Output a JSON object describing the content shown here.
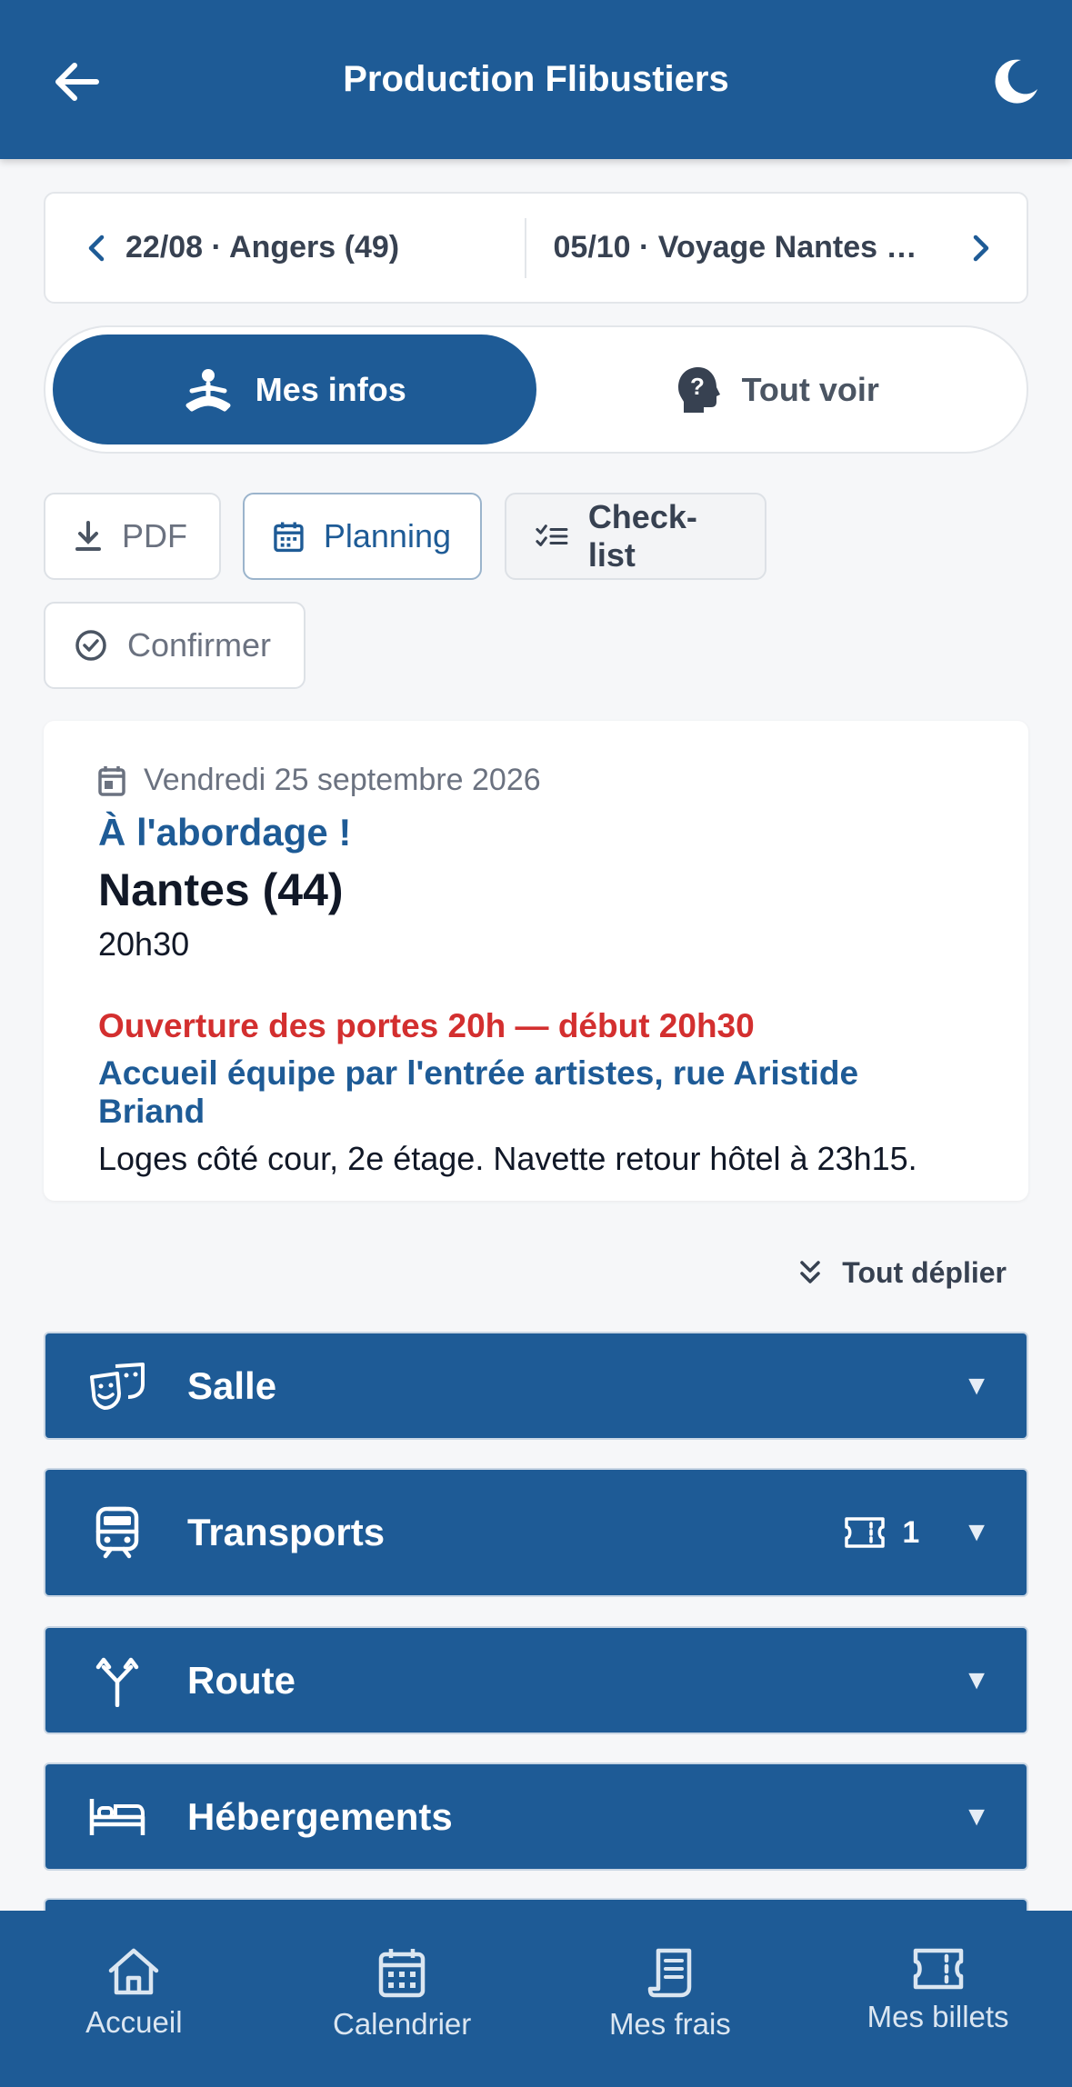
{
  "header": {
    "title": "Production Flibustiers",
    "back_icon": "arrow-left-icon",
    "theme_icon": "moon-icon"
  },
  "date_nav": {
    "prev_label": "22/08 · Angers (49)",
    "next_label": "05/10 · Voyage Nantes …"
  },
  "view_toggle": {
    "mine_label": "Mes infos",
    "all_label": "Tout voir"
  },
  "actions": {
    "pdf": "PDF",
    "planning": "Planning",
    "checklist": "Check-list",
    "confirm": "Confirmer"
  },
  "event": {
    "date": "Vendredi 25 septembre 2026",
    "show_title": "À l'abordage !",
    "city": "Nantes (44)",
    "time": "20h30",
    "note_alert": "Ouverture des portes 20h — début 20h30",
    "note_info": "Accueil équipe par l'entrée artistes, rue Aristide Briand",
    "note_plain": "Loges côté cour, 2e étage. Navette retour hôtel à 23h15."
  },
  "expand_all": "Tout déplier",
  "sections": [
    {
      "label": "Salle",
      "icon": "theater-masks-icon"
    },
    {
      "label": "Transports",
      "icon": "train-icon",
      "badge_icon": "ticket-icon",
      "badge_count": "1"
    },
    {
      "label": "Route",
      "icon": "route-fork-icon"
    },
    {
      "label": "Hébergements",
      "icon": "bed-icon"
    }
  ],
  "bottom_nav": [
    {
      "label": "Accueil",
      "icon": "home-icon"
    },
    {
      "label": "Calendrier",
      "icon": "calendar-icon"
    },
    {
      "label": "Mes frais",
      "icon": "receipt-icon"
    },
    {
      "label": "Mes billets",
      "icon": "ticket-icon"
    }
  ],
  "colors": {
    "primary": "#1e5b96",
    "alert": "#d32f2f",
    "background": "#f6f7f9"
  }
}
